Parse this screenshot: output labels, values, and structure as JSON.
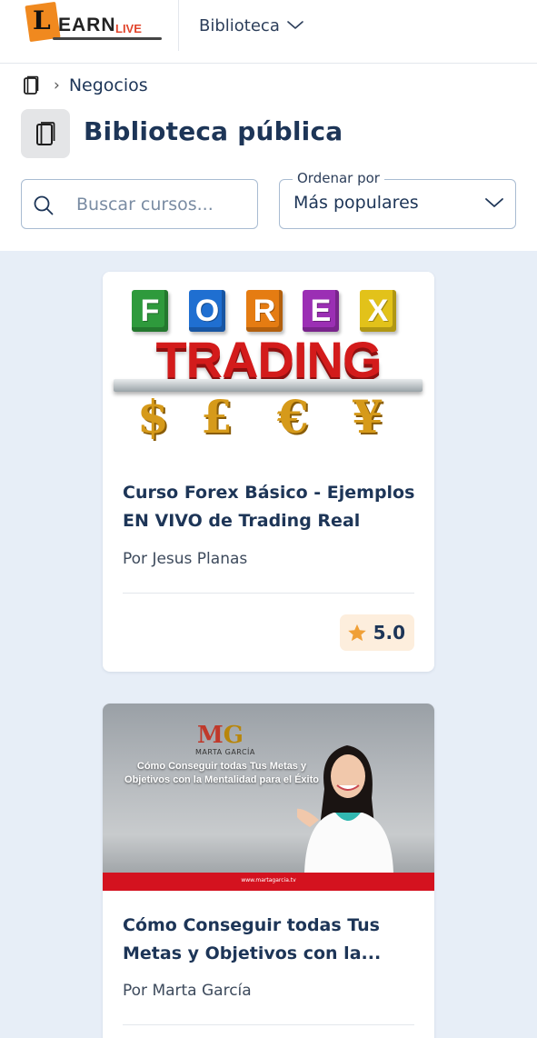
{
  "header": {
    "logo": {
      "letter": "L",
      "text": "EARN",
      "suffix": "LIVE"
    },
    "nav_label": "Biblioteca"
  },
  "breadcrumb": {
    "items": [
      "Negocios"
    ]
  },
  "page": {
    "title": "Biblioteca pública"
  },
  "search": {
    "placeholder": "Buscar cursos..."
  },
  "sort": {
    "label": "Ordenar por",
    "value": "Más populares"
  },
  "courses": [
    {
      "title": "Curso Forex Básico - Ejemplos EN VIVO de Trading Real",
      "author": "Por Jesus Planas",
      "rating": "5.0",
      "thumb": {
        "letters": [
          "F",
          "O",
          "R",
          "E",
          "X"
        ],
        "word": "TRADING",
        "currencies": [
          "$",
          "£",
          "€",
          "¥"
        ]
      }
    },
    {
      "title": "Cómo Conseguir todas Tus Metas y Objetivos con la...",
      "author": "Por Marta García",
      "thumb": {
        "logo_m": "M",
        "logo_g": "G",
        "brand": "MARTA GARCÍA",
        "caption": "Cómo Conseguir todas Tus Metas y Objetivos con la Mentalidad para el Éxito",
        "url": "www.martagarcia.tv"
      }
    }
  ],
  "colors": {
    "primary_text": "#1d3557",
    "page_bg": "#e7eef7",
    "rating_bg": "#fdeedd",
    "star": "#f0a037",
    "logo_orange": "#f0891f"
  }
}
